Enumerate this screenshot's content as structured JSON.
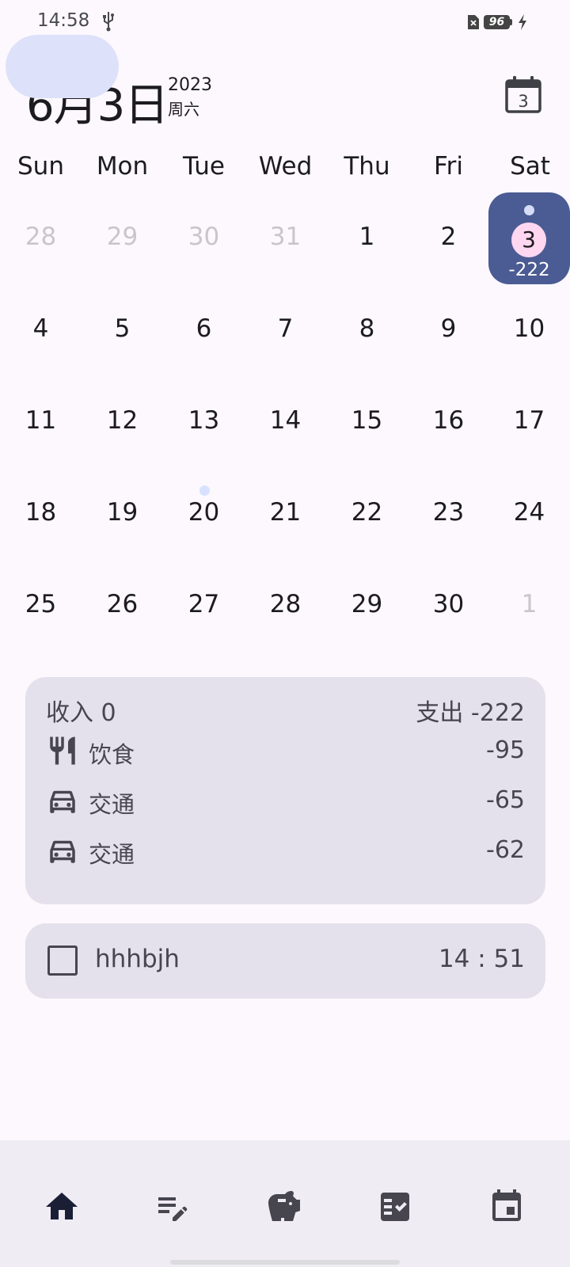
{
  "status_bar": {
    "time": "14:58",
    "battery_level": "96",
    "icons": [
      "usb-icon",
      "sim-missing-icon",
      "battery-icon",
      "charging-bolt-icon"
    ]
  },
  "header": {
    "date": "6月3日",
    "year": "2023",
    "weekday": "周六",
    "today_button_day": "3"
  },
  "calendar": {
    "weekdays": [
      "Sun",
      "Mon",
      "Tue",
      "Wed",
      "Thu",
      "Fri",
      "Sat"
    ],
    "weeks": [
      [
        "28",
        "29",
        "30",
        "31",
        "1",
        "2",
        "3"
      ],
      [
        "4",
        "5",
        "6",
        "7",
        "8",
        "9",
        "10"
      ],
      [
        "11",
        "12",
        "13",
        "14",
        "15",
        "16",
        "17"
      ],
      [
        "18",
        "19",
        "20",
        "21",
        "22",
        "23",
        "24"
      ],
      [
        "25",
        "26",
        "27",
        "28",
        "29",
        "30",
        "1"
      ]
    ],
    "selected_day": "3",
    "selected_amount": "-222",
    "event_dot_days": [
      "3",
      "20"
    ]
  },
  "summary": {
    "income": "收入 0",
    "expense": "支出 -222",
    "transactions": [
      {
        "icon": "restaurant-icon",
        "name": "饮食",
        "amount": "-95"
      },
      {
        "icon": "car-icon",
        "name": "交通",
        "amount": "-65"
      },
      {
        "icon": "car-icon",
        "name": "交通",
        "amount": "-62"
      }
    ]
  },
  "todo": {
    "title": "hhhbjh",
    "time": "14 : 51",
    "checked": false
  },
  "bottom_nav": {
    "items": [
      "home-icon",
      "edit-note-icon",
      "piggy-bank-icon",
      "checklist-icon",
      "calendar-icon"
    ],
    "active": "home-icon"
  },
  "colors": {
    "accent": "#4b5b93",
    "selected_circle": "#ffd7f1",
    "card_bg": "#e4e1ec",
    "nav_active": "#dde1f9"
  }
}
